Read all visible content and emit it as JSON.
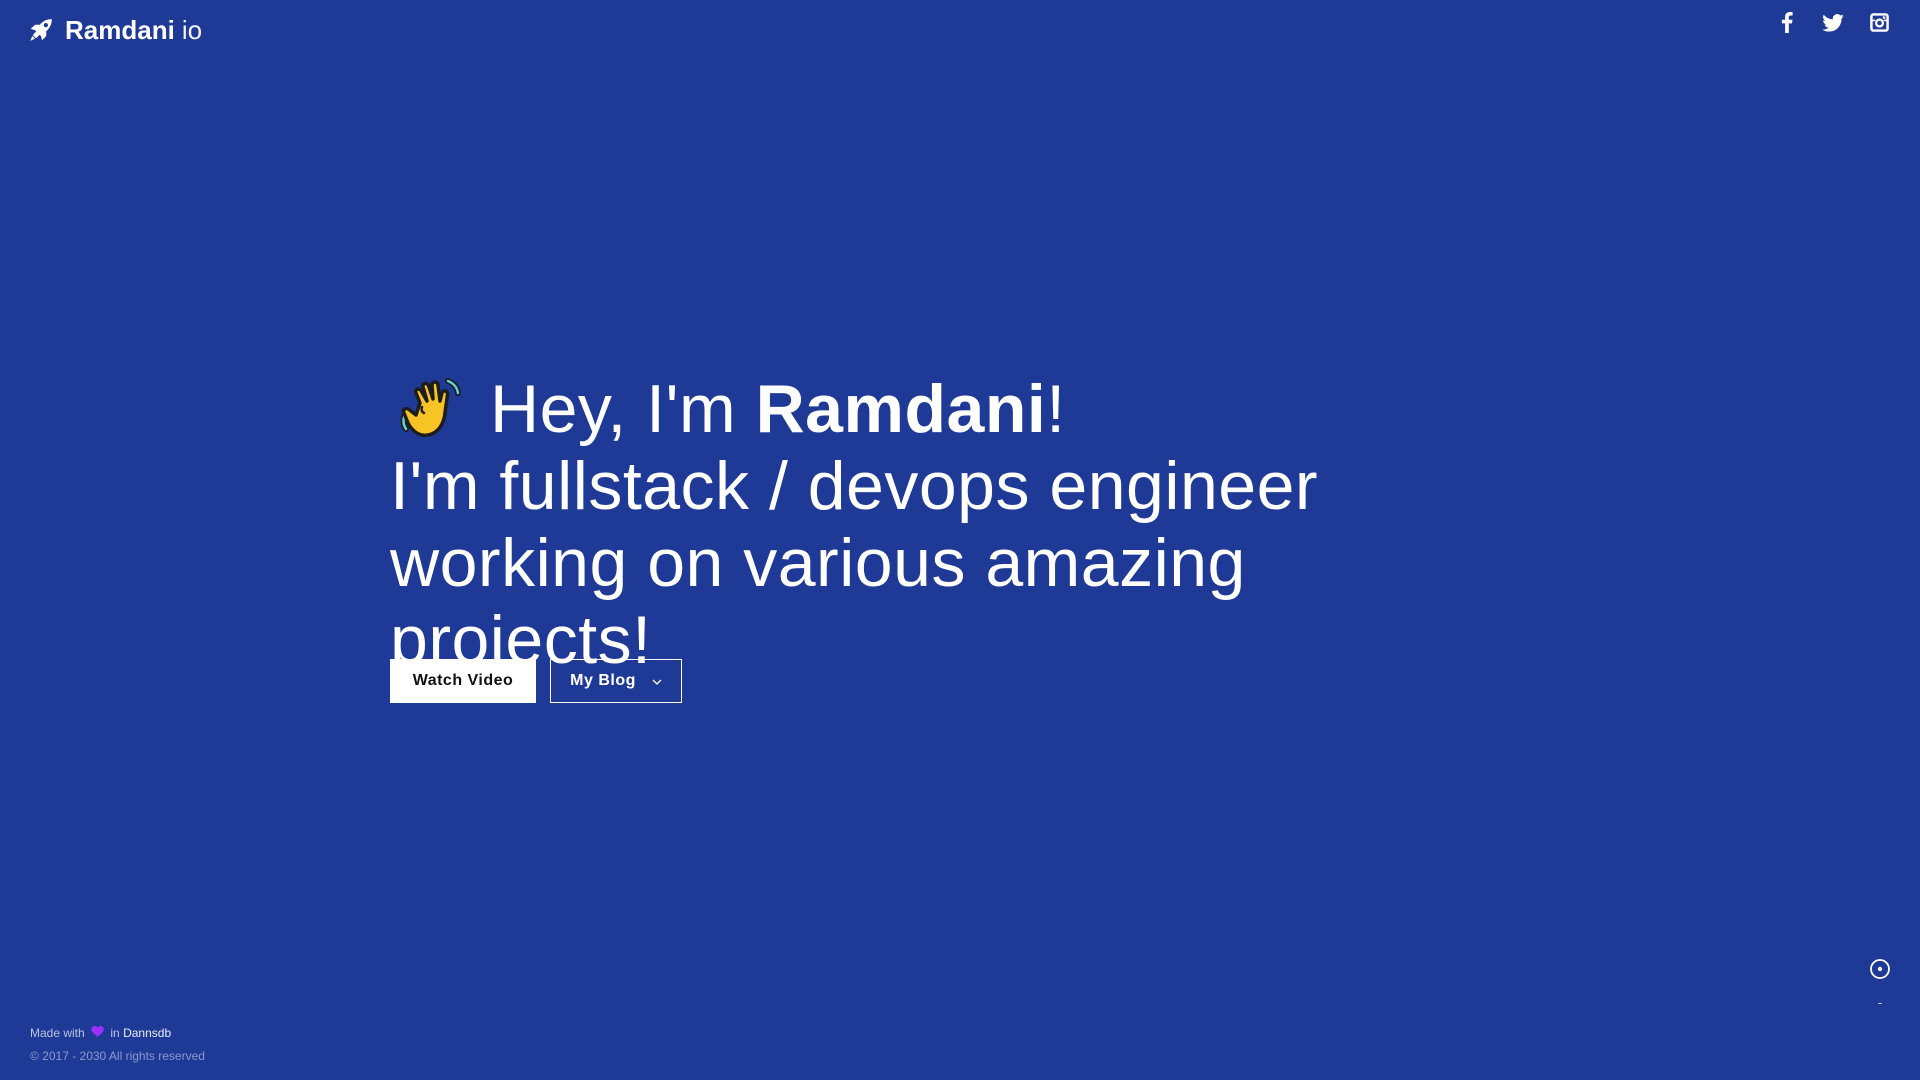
{
  "brand": {
    "name": "Ramdani",
    "suffix": "io",
    "icon": "rocket-icon"
  },
  "social": [
    {
      "name": "facebook",
      "icon": "facebook-icon"
    },
    {
      "name": "twitter",
      "icon": "twitter-icon"
    },
    {
      "name": "instagram",
      "icon": "instagram-icon"
    }
  ],
  "hero": {
    "emoji": "waving-hand-emoji",
    "greeting_prefix": "Hey, I'm ",
    "name": "Ramdani",
    "greeting_suffix": "!",
    "subtitle": "I'm fullstack / devops engineer working on various amazing projects!"
  },
  "buttons": {
    "watch_video": "Watch Video",
    "my_blog": "My Blog",
    "my_blog_icon": "chevron-down-icon"
  },
  "footer": {
    "made_with": "Made with",
    "heart_icon": "heart-icon",
    "in_text": "in",
    "author": "Dannsdb",
    "copyright": "© 2017 - 2030 All rights reserved"
  },
  "colors": {
    "background": "#1f3a96",
    "text": "#ffffff",
    "heart": "#9b30ff"
  }
}
